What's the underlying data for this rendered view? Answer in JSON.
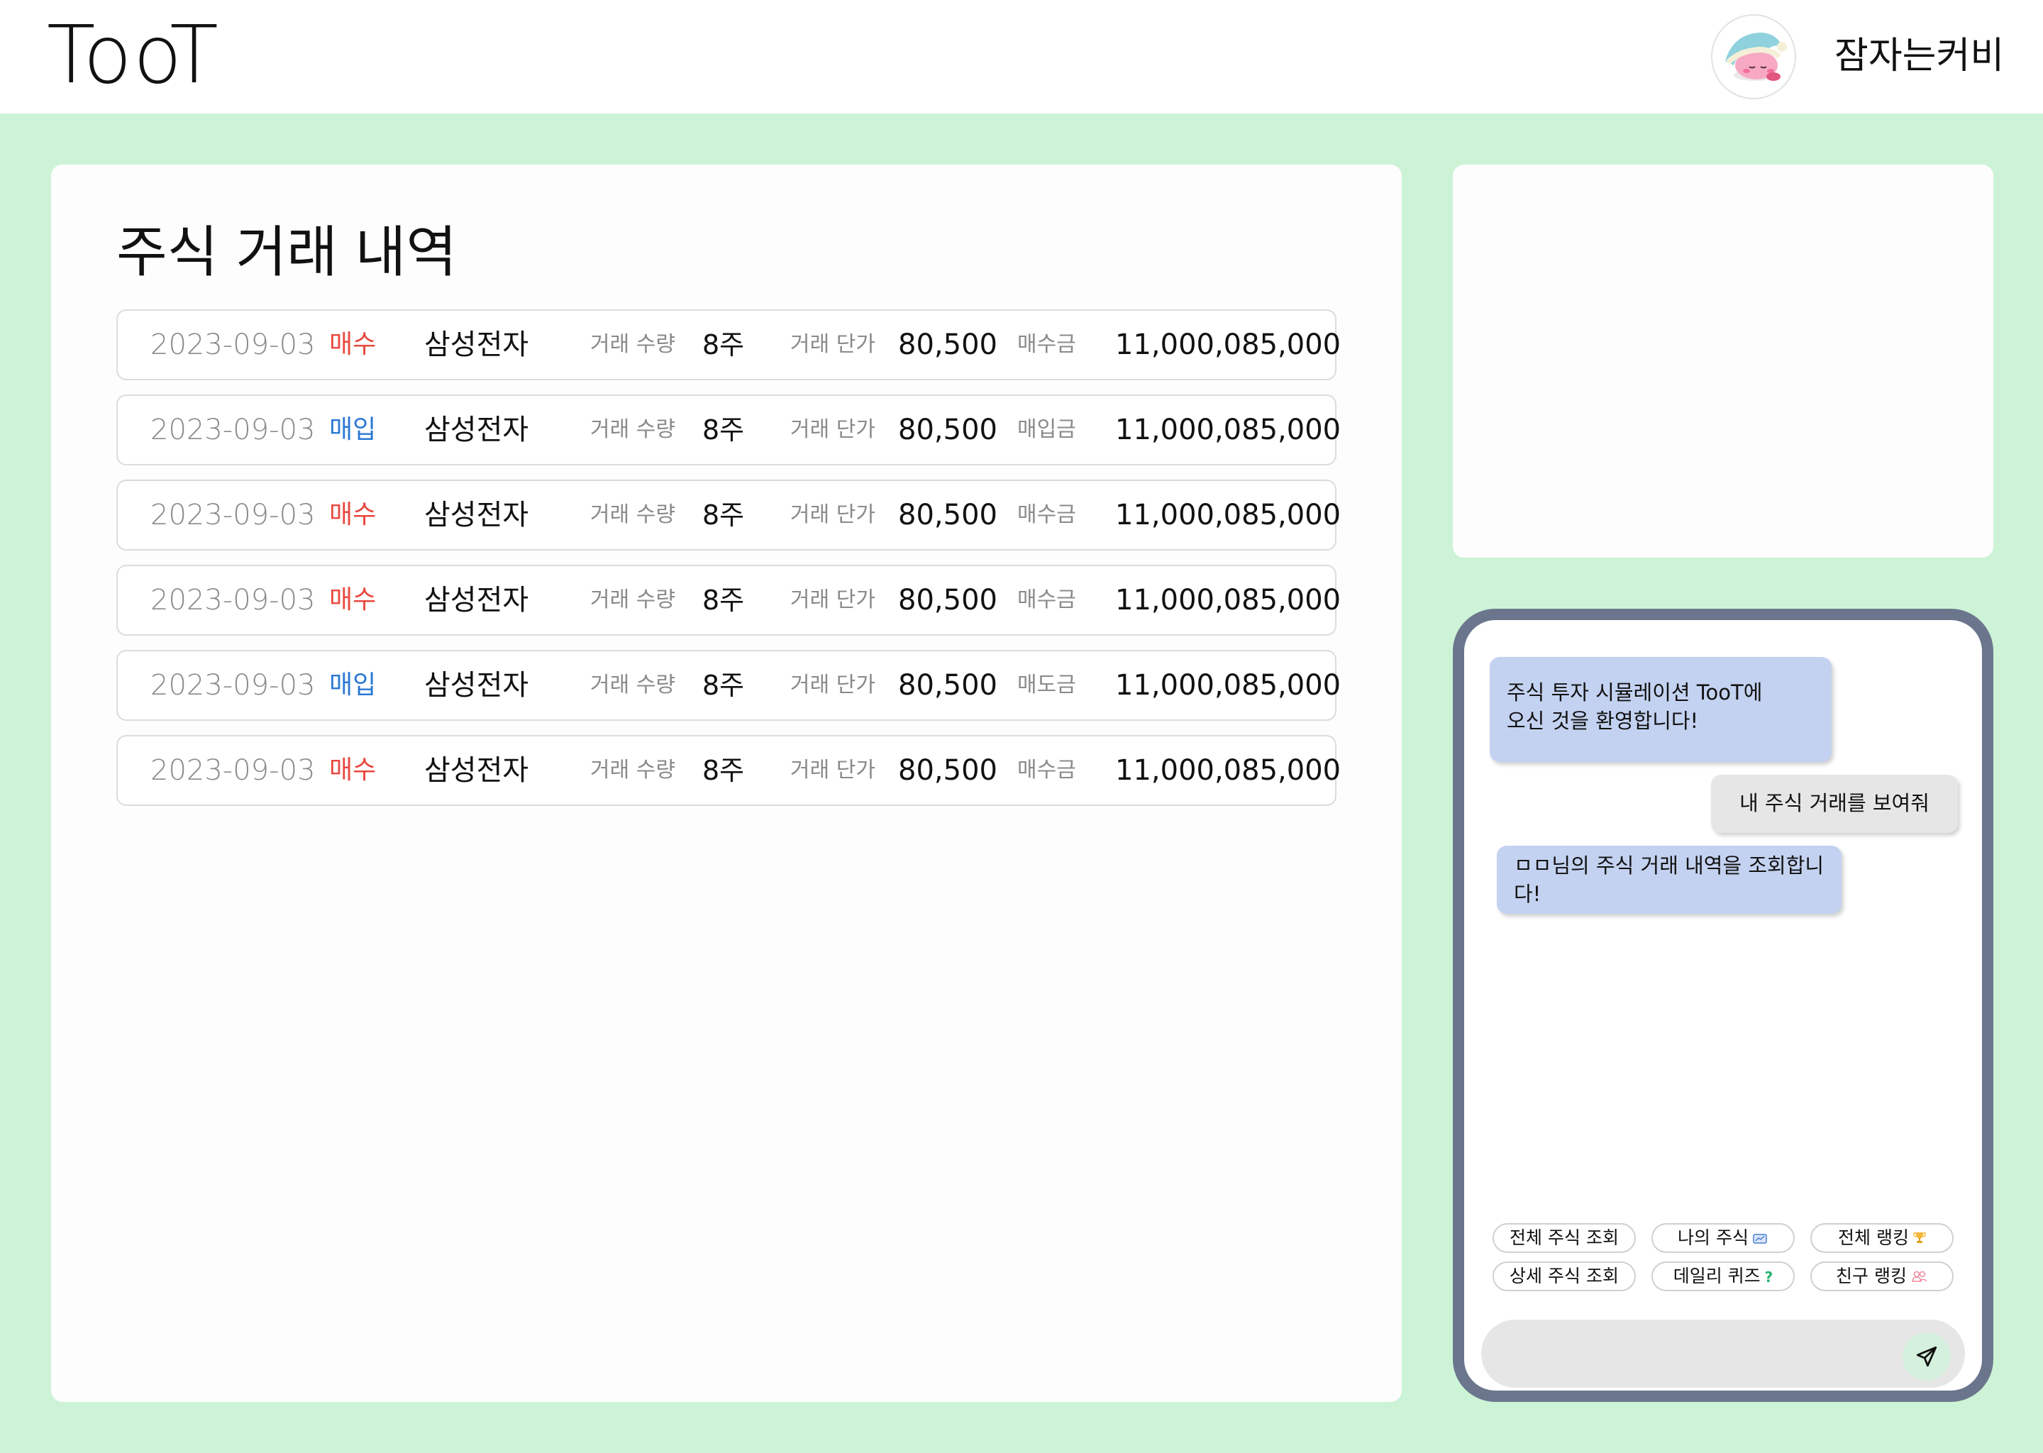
{
  "header": {
    "logo": "TooT",
    "username": "잠자는커비"
  },
  "main": {
    "title": "주식 거래 내역",
    "transactions": [
      {
        "date": "2023-09-03",
        "type": "매수",
        "type_color": "#e8483f",
        "name": "삼성전자",
        "qty_label": "거래 수량",
        "qty": "8주",
        "price_label": "거래 단가",
        "price": "80,500",
        "amount_label": "매수금",
        "amount": "11,000,085,000"
      },
      {
        "date": "2023-09-03",
        "type": "매입",
        "type_color": "#2c78d4",
        "name": "삼성전자",
        "qty_label": "거래 수량",
        "qty": "8주",
        "price_label": "거래 단가",
        "price": "80,500",
        "amount_label": "매입금",
        "amount": "11,000,085,000"
      },
      {
        "date": "2023-09-03",
        "type": "매수",
        "type_color": "#e8483f",
        "name": "삼성전자",
        "qty_label": "거래 수량",
        "qty": "8주",
        "price_label": "거래 단가",
        "price": "80,500",
        "amount_label": "매수금",
        "amount": "11,000,085,000"
      },
      {
        "date": "2023-09-03",
        "type": "매수",
        "type_color": "#e8483f",
        "name": "삼성전자",
        "qty_label": "거래 수량",
        "qty": "8주",
        "price_label": "거래 단가",
        "price": "80,500",
        "amount_label": "매수금",
        "amount": "11,000,085,000"
      },
      {
        "date": "2023-09-03",
        "type": "매입",
        "type_color": "#2c78d4",
        "name": "삼성전자",
        "qty_label": "거래 수량",
        "qty": "8주",
        "price_label": "거래 단가",
        "price": "80,500",
        "amount_label": "매도금",
        "amount": "11,000,085,000"
      },
      {
        "date": "2023-09-03",
        "type": "매수",
        "type_color": "#e8483f",
        "name": "삼성전자",
        "qty_label": "거래 수량",
        "qty": "8주",
        "price_label": "거래 단가",
        "price": "80,500",
        "amount_label": "매수금",
        "amount": "11,000,085,000"
      }
    ]
  },
  "chat": {
    "messages": [
      {
        "role": "bot",
        "lines": [
          "주식 투자 시뮬레이션 TooT에",
          "오신 것을 환영합니다!"
        ]
      },
      {
        "role": "user",
        "lines": [
          "내 주식 거래를 보여줘"
        ]
      },
      {
        "role": "bot",
        "lines": [
          "ㅁㅁ님의 주식 거래 내역을 조회합니",
          "다!"
        ]
      }
    ],
    "quick_buttons": [
      {
        "label": "전체 주식 조회",
        "icon": ""
      },
      {
        "label": "나의 주식",
        "icon": "chart-icon"
      },
      {
        "label": "전체 랭킹",
        "icon": "trophy-icon"
      },
      {
        "label": "상세 주식 조회",
        "icon": ""
      },
      {
        "label": "데일리 퀴즈",
        "icon": "question-icon"
      },
      {
        "label": "친구 랭킹",
        "icon": "people-icon"
      }
    ],
    "input_value": "",
    "send_icon": "send-icon"
  },
  "colors": {
    "background": "#cdf3d6",
    "buy": "#e8483f",
    "purchase": "#2c78d4",
    "chat_frame": "#6b768d",
    "bot_bubble": "#c4d2f1",
    "user_bubble": "#e6e6e6"
  }
}
